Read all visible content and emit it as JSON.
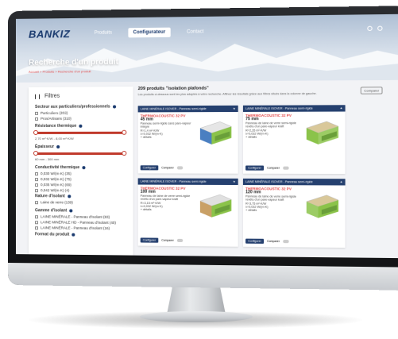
{
  "site": {
    "logo": "BANKIZ",
    "nav": [
      "Produits",
      "Configurateur",
      "Contact"
    ],
    "active_nav": 1,
    "page_title": "Recherche d'un produit",
    "breadcrumb": "Accueil > Produits > Recherche d'un produit"
  },
  "sidebar": {
    "filters_label": "Filtres",
    "sec1_title": "Secteur aux particuliers/professionnels",
    "sec1_opts": [
      "Particuliers (203)",
      "Pros/Artisans (310)"
    ],
    "sec2_title": "Résistance thermique",
    "sec2_range": "2,70 m²·K/W - 8,00 m²·K/W",
    "sec3_title": "Épaisseur",
    "sec3_range": "60 mm - 300 mm",
    "sec4_title": "Conductivité thermique",
    "sec4_opts": [
      "0,030 W/(m·K) (35)",
      "0,032 W/(m·K) (75)",
      "0,035 W/(m·K) (69)",
      "0,042 W/(m·K) (4)"
    ],
    "sec5_title": "Nature d'isolant",
    "sec5_opts": [
      "Laine de verre (139)"
    ],
    "sec6_title": "Gamme d'isolant",
    "sec6_opts": [
      "LAINE MINÉRALE - Panneau d'isolant (83)",
      "LAINE MINÉRALE HD - Panneau d'isolant (40)",
      "LAINE MINÉRALE - Panneau d'isolant (16)"
    ],
    "sec7_title": "Format du produit"
  },
  "main": {
    "results_title": "209 produits \"isolation plafonds\"",
    "results_sub": "Les produits ci-dessous sont les plus adaptés à votre recherche. Affinez les résultats grâce aux filtres situés dans la colonne de gauche.",
    "compare_label": "Comparer",
    "cards": [
      {
        "head": "LAINE MINÉRALE ISOVER - Panneau semi-rigide",
        "name": "THERMOACOUSTIC 32 PV",
        "thick": "45 mm",
        "desc": "Panneau semi-rigide sans pare-vapeur intégré",
        "r": "R=1,4 m²·K/W",
        "lambda": "λ=0,032 W/(m·K)",
        "extra": "+ détails"
      },
      {
        "head": "LAINE MINÉRALE ISOVER - Panneau semi-rigide",
        "name": "THERMOACOUSTIC 32 PV",
        "thick": "75 mm",
        "desc": "Panneau de laine de verre semi-rigide revêtu d'un pare-vapeur kraft",
        "r": "R=2,35 m²·K/W",
        "lambda": "λ=0,032 W/(m·K)",
        "extra": "+ détails"
      },
      {
        "head": "LAINE MINÉRALE ISOVER - Panneau semi-rigide",
        "name": "THERMOACOUSTIC 32 PV",
        "thick": "100 mm",
        "desc": "Panneau de laine de verre semi-rigide revêtu d'un pare-vapeur kraft",
        "r": "R=3,15 m²·K/W",
        "lambda": "λ=0,032 W/(m·K)",
        "extra": "+ détails"
      },
      {
        "head": "LAINE MINÉRALE ISOVER - Panneau semi-rigide",
        "name": "THERMOACOUSTIC 32 PV",
        "thick": "120 mm",
        "desc": "Panneau de laine de verre semi-rigide revêtu d'un pare-vapeur kraft",
        "r": "R=3,75 m²·K/W",
        "lambda": "λ=0,032 W/(m·K)",
        "extra": "+ détails"
      }
    ],
    "config_label": "Configurer",
    "compare_toggle": "Comparer"
  },
  "colors": {
    "accent": "#25406f",
    "red": "#e34a4a"
  },
  "icons": [
    "search-icon",
    "user-icon",
    "filter-icon",
    "info-icon",
    "star-icon",
    "product-image"
  ]
}
